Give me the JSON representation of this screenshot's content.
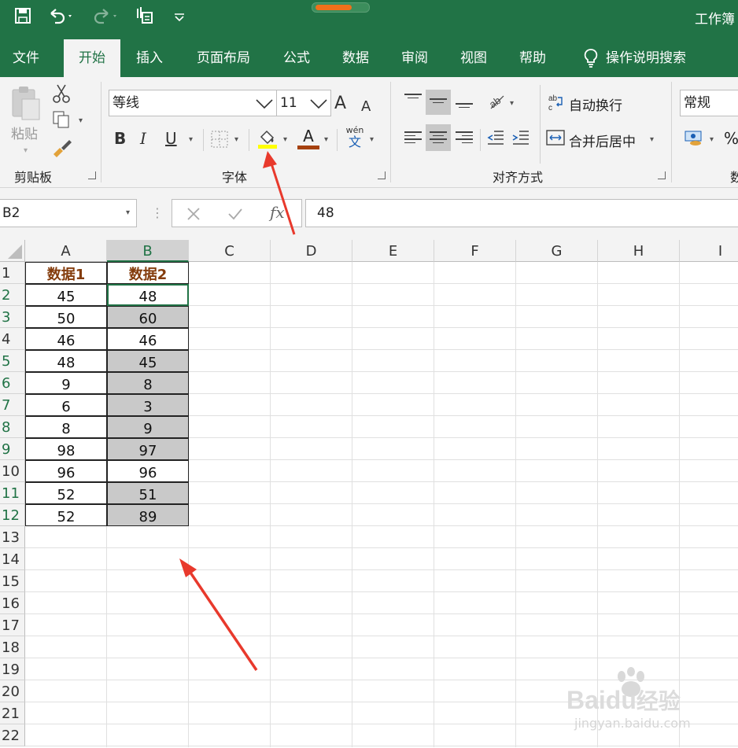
{
  "window": {
    "title": "工作簿"
  },
  "quick_access": {
    "save_icon": "save-icon",
    "undo_icon": "undo-icon",
    "redo_icon": "redo-icon",
    "touch_icon": "touch-mode-icon",
    "customize_icon": "customize-qat-icon"
  },
  "tabs": [
    {
      "label": "文件"
    },
    {
      "label": "开始"
    },
    {
      "label": "插入"
    },
    {
      "label": "页面布局"
    },
    {
      "label": "公式"
    },
    {
      "label": "数据"
    },
    {
      "label": "审阅"
    },
    {
      "label": "视图"
    },
    {
      "label": "帮助"
    }
  ],
  "active_tab": "开始",
  "tell_me": {
    "label": "操作说明搜索",
    "icon": "lightbulb-icon"
  },
  "ribbon": {
    "clipboard": {
      "group_label": "剪贴板",
      "paste_label": "粘贴"
    },
    "font": {
      "group_label": "字体",
      "font_name": "等线",
      "font_size": "11",
      "bold": "B",
      "italic": "I",
      "underline": "U",
      "grow": "A",
      "shrink": "A",
      "font_color_glyph": "A",
      "phonetic_top": "wén",
      "phonetic_bottom": "文",
      "fill_color": "#ffff00",
      "text_color": "#c0504d"
    },
    "alignment": {
      "group_label": "对齐方式",
      "wrap_text": "自动换行",
      "merge_center": "合并后居中"
    },
    "number": {
      "format": "常规",
      "group_label_partial": "数",
      "percent": "%"
    }
  },
  "formula_bar": {
    "name_box": "B2",
    "fx": "fx",
    "value": "48"
  },
  "columns": [
    "A",
    "B",
    "C",
    "D",
    "E",
    "F",
    "G",
    "H",
    "I"
  ],
  "selected_column": "B",
  "rows": [
    "1",
    "2",
    "3",
    "4",
    "5",
    "6",
    "7",
    "8",
    "9",
    "10",
    "11",
    "12",
    "13",
    "14",
    "15",
    "16",
    "17",
    "18",
    "19",
    "20",
    "21",
    "22"
  ],
  "highlight_rows": [
    "2",
    "3",
    "5",
    "6",
    "7",
    "8",
    "9",
    "11",
    "12"
  ],
  "table": {
    "headers": [
      "数据1",
      "数据2"
    ],
    "data": [
      [
        "45",
        "48"
      ],
      [
        "50",
        "60"
      ],
      [
        "46",
        "46"
      ],
      [
        "48",
        "45"
      ],
      [
        "9",
        "8"
      ],
      [
        "6",
        "3"
      ],
      [
        "8",
        "9"
      ],
      [
        "98",
        "97"
      ],
      [
        "96",
        "96"
      ],
      [
        "52",
        "51"
      ],
      [
        "52",
        "89"
      ]
    ],
    "gray_b_rows": [
      false,
      true,
      false,
      true,
      true,
      true,
      true,
      true,
      false,
      true,
      true
    ]
  },
  "watermark": {
    "brand_part1": "Bai",
    "brand_part2": "du",
    "brand_part3": "经验",
    "url": "jingyan.baidu.com"
  },
  "colors": {
    "excel_green": "#217346",
    "header_text": "#843c0c",
    "fill_gray": "#c9c9c9",
    "arrow_red": "#e8392c"
  }
}
